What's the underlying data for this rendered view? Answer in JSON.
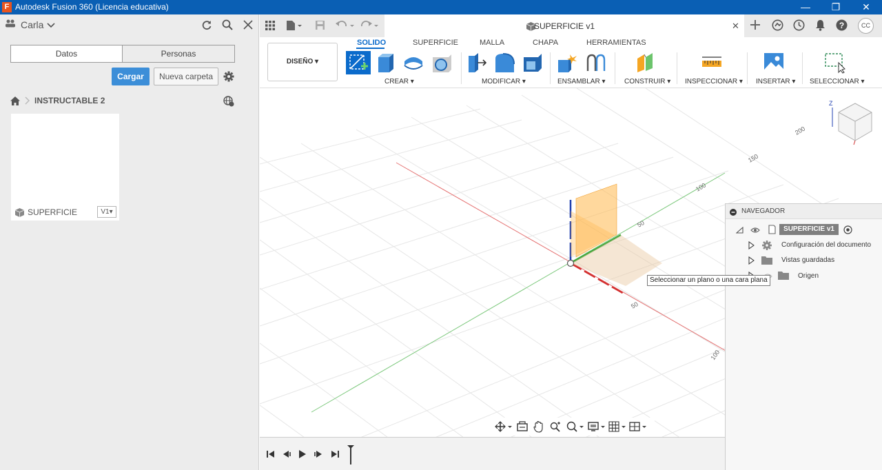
{
  "window": {
    "title": "Autodesk Fusion 360 (Licencia educativa)",
    "minimize": "—",
    "restore": "❐",
    "close": "✕"
  },
  "data_panel": {
    "user": "Carla",
    "tabs": [
      "Datos",
      "Personas"
    ],
    "upload_label": "Cargar",
    "new_folder_label": "Nueva carpeta",
    "breadcrumb": "INSTRUCTABLE 2",
    "file": {
      "name": "SUPERFICIE",
      "version": "V1▾"
    }
  },
  "document": {
    "title": "SUPERFICIE v1",
    "close": "✕"
  },
  "profile": {
    "initials": "CC"
  },
  "ribbon": {
    "workspace": "DISEÑO",
    "tabs": [
      "SOLIDO",
      "SUPERFICIE",
      "MALLA",
      "CHAPA",
      "HERRAMIENTAS"
    ],
    "active_tab": "SOLIDO",
    "groups": [
      "CREAR",
      "MODIFICAR",
      "ENSAMBLAR",
      "CONSTRUIR",
      "INSPECCIONAR",
      "INSERTAR",
      "SELECCIONAR"
    ]
  },
  "viewport": {
    "axis_labels": [
      "200",
      "150",
      "100",
      "50",
      "50",
      "100"
    ],
    "viewcube_label": "Z",
    "tooltip": "Seleccionar un plano o una cara plana"
  },
  "navigator": {
    "title": "NAVEGADOR",
    "root": "SUPERFICIE v1",
    "items": [
      "Configuración del documento",
      "Vistas guardadas",
      "Origen"
    ]
  },
  "colors": {
    "accent": "#0b6bcb",
    "title_bar": "#0a5fb4",
    "upload_button": "#3c8ed8",
    "x_axis": "#d32f2f",
    "y_axis": "#4caf50",
    "z_axis": "#1f3fb0",
    "plane": "#ffb84d"
  }
}
